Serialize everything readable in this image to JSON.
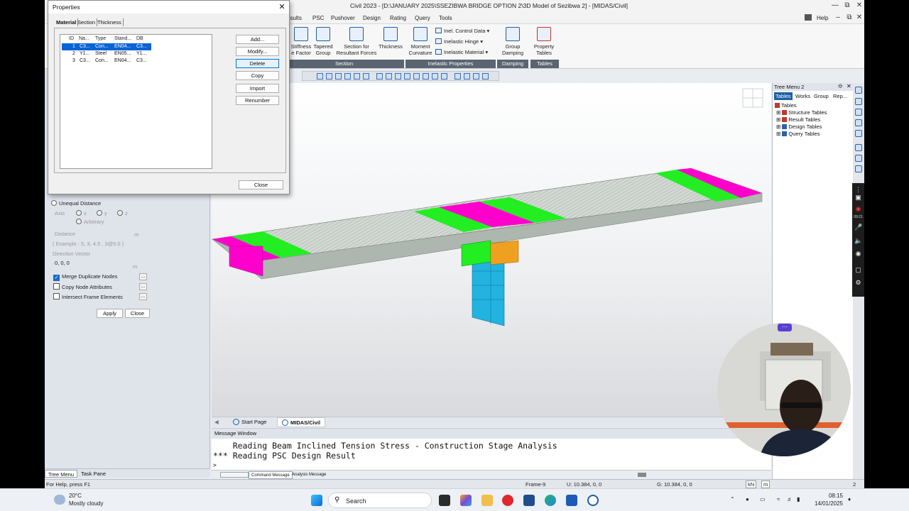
{
  "window": {
    "title": "Civil 2023 - [D:\\JANUARY 2025\\SSEZIBWA BRIDGE OPTION 2\\3D Model of Sezibwa 2] - [MIDAS/Civil]",
    "help_label": "Help"
  },
  "menu": [
    "esults",
    "PSC",
    "Pushover",
    "Design",
    "Rating",
    "Query",
    "Tools"
  ],
  "ribbon": {
    "stiffness_label": "Stiffness\ne Factor",
    "tapered_group_label": "Tapered\nGroup",
    "section_resultant_label": "Section for\nResultant Forces",
    "thickness_label": "Thickness",
    "moment_curvature_label": "Moment\nCurvature",
    "inel_control_data": "Inel. Control Data",
    "inelastic_hinge": "Inelastic Hinge",
    "inelastic_material": "Inelastic Material",
    "group_damping_label": "Group\nDamping",
    "property_tables_label": "Property\nTables",
    "groups": {
      "section": "Section",
      "inelastic": "Inelastic Properties",
      "damping": "Damping",
      "tables": "Tables"
    }
  },
  "dialog": {
    "title": "Properties",
    "tabs": [
      "Material",
      "Section",
      "Thickness"
    ],
    "columns": [
      "ID",
      "Na...",
      "Type",
      "Stand...",
      "DB"
    ],
    "rows": [
      {
        "id": "1",
        "name": "C3...",
        "type": "Con...",
        "standard": "EN04...",
        "db": "C3..."
      },
      {
        "id": "2",
        "name": "Y1...",
        "type": "Steel",
        "standard": "EN05...",
        "db": "Y1..."
      },
      {
        "id": "3",
        "name": "C3...",
        "type": "Con...",
        "standard": "EN04...",
        "db": "C3..."
      }
    ],
    "buttons": [
      "Add...",
      "Modify...",
      "Delete",
      "Copy",
      "Import",
      "Renumber"
    ],
    "close_label": "Close"
  },
  "left_panel": {
    "unequal_distance": "Unequal Distance",
    "axis_label": "Axis",
    "axis_x": "x",
    "axis_y": "y",
    "axis_z": "z",
    "arbitrary": "Arbitrary",
    "distance_label": "Distance",
    "distance_unit": "m",
    "example": "( Example :   5, 3, 4.5 , 3@5.0 )",
    "direction_vector_label": "Direction Vector",
    "direction_vector_value": "0, 0, 0",
    "direction_unit": "m",
    "merge_duplicate_nodes": "Merge Duplicate Nodes",
    "copy_node_attributes": "Copy Node Attributes",
    "intersect_frame_elements": "Intersect Frame Elements",
    "apply_label": "Apply",
    "close_label": "Close",
    "tabs": [
      "Tree Menu",
      "Task Pane"
    ]
  },
  "doc_tabs": [
    "Start Page",
    "MIDAS/Civil"
  ],
  "message_window": {
    "title": "Message Window",
    "lines": [
      "    Reading Beam Inclined Tension Stress - Construction Stage Analysis",
      "*** Reading PSC Design Result"
    ],
    "prompt": ">",
    "tabs": [
      "Command Message",
      "Analysis Message"
    ]
  },
  "tree_menu": {
    "title": "Tree Menu 2",
    "tabs": [
      "Tables",
      "Works",
      "Group",
      "Rep..."
    ],
    "items": [
      "Tables",
      "Structure Tables",
      "Result Tables",
      "Design Tables",
      "Query Tables"
    ]
  },
  "status": {
    "help": "For Help, press F1",
    "frame": "Frame-9",
    "u_coord": "U: 10.384, 0, 0",
    "g_coord": "G: 10.384, 0, 0",
    "unit_force": "kN",
    "unit_length": "m",
    "page": "2"
  },
  "taskbar": {
    "weather_temp": "20°C",
    "weather_text": "Mostly cloudy",
    "search_placeholder": "Search",
    "time": "08:15",
    "date": "14/01/2025"
  },
  "recbar": {
    "time": "09:21"
  },
  "colors": {
    "magenta": "#ff00cc",
    "green": "#22ee22",
    "deck": "#cfd4d0",
    "pier": "#22b3e0",
    "bearing": "#f0a020",
    "accent": "#0a64d6"
  }
}
